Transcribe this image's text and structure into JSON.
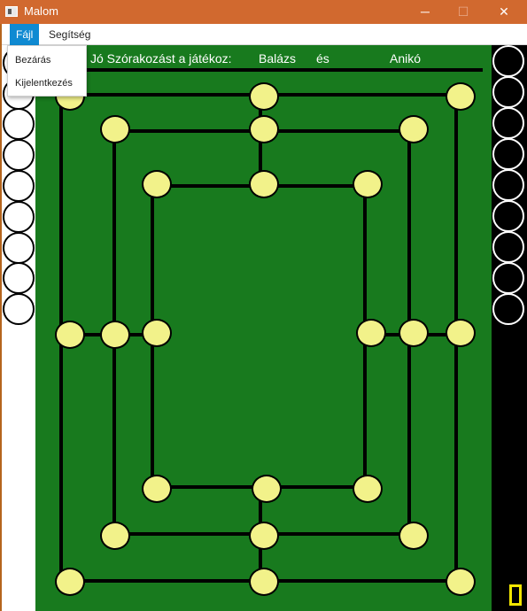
{
  "window": {
    "title": "Malom"
  },
  "titlebar": {
    "minimize_glyph": "─",
    "maximize_glyph": "☐",
    "close_glyph": "✕"
  },
  "menubar": {
    "file_label": "Fájl",
    "help_label": "Segítség"
  },
  "file_menu": {
    "items": [
      "Bezárás",
      "Kijelentkezés"
    ]
  },
  "header": {
    "greeting": "Jó Szórakozást a játékoz:",
    "player1": "Balázs",
    "connector": "és",
    "player2": "Anikó"
  },
  "colors": {
    "board": "#187a1e",
    "node": "#f2f28a",
    "titlebar": "#d1692f",
    "menu_active": "#0f8ad2",
    "indicator": "#f2e600"
  },
  "pieces": {
    "white_remaining": 9,
    "black_remaining": 9
  }
}
